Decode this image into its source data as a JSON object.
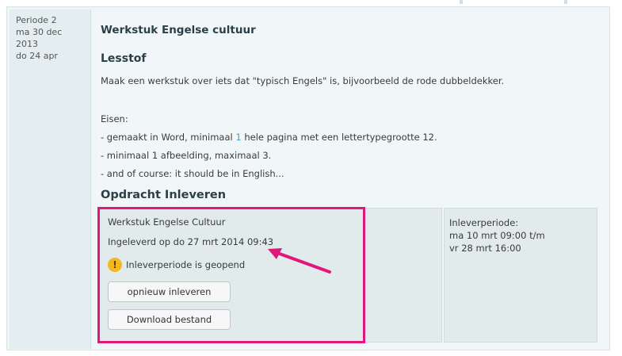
{
  "period": {
    "line1": "Periode 2",
    "line2": "ma 30 dec",
    "line3": "2013",
    "line4": "do 24 apr"
  },
  "assignment": {
    "title": "Werkstuk Engelse cultuur",
    "lesstof_heading": "Lesstof",
    "description": "Maak een werkstuk over iets dat \"typisch Engels\" is, bijvoorbeeld de rode dubbeldekker.",
    "requirements_label": "Eisen:",
    "requirement1_pre": "- gemaakt in Word, minimaal ",
    "requirement1_num": "1",
    "requirement1_post": " hele pagina met een lettertypegrootte 12.",
    "requirement2": "- minimaal 1 afbeelding, maximaal 3.",
    "requirement3": "- and of course: it should be in English..."
  },
  "submission": {
    "heading": "Opdracht Inleveren",
    "item_title": "Werkstuk Engelse Cultuur",
    "handed_in": "Ingeleverd op do 27 mrt 2014 09:43",
    "status_text": "Inleverperiode is geopend",
    "status_icon": "warning-icon",
    "resubmit_label": "opnieuw inleveren",
    "download_label": "Download bestand"
  },
  "period_info": {
    "label": "Inleverperiode:",
    "line1": "ma 10 mrt 09:00 t/m",
    "line2": "vr 28 mrt 16:00"
  },
  "colors": {
    "highlight": "#e0187d",
    "warning": "#f4b81e",
    "accent_number": "#3aa3c7"
  }
}
